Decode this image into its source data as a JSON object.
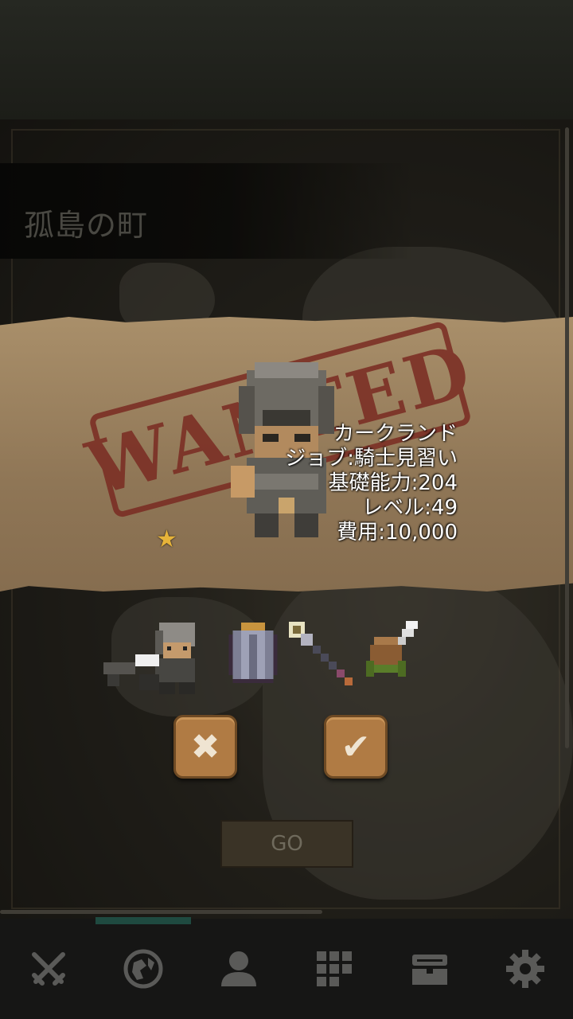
{
  "location": {
    "title": "孤島の町"
  },
  "stamp": {
    "text": "WANTED"
  },
  "recruit": {
    "name": "カークランド",
    "job": "ジョブ:騎士見習い",
    "base_power": "基礎能力:204",
    "level": "レベル:49",
    "cost": "費用:10,000",
    "stars": "★"
  },
  "equipment": {
    "icons": [
      "knight-sprite",
      "armor-icon",
      "staff-icon",
      "helmet-feather-icon"
    ]
  },
  "buttons": {
    "cancel_glyph": "✖",
    "confirm_glyph": "✔",
    "go_label": "GO"
  },
  "tabs": [
    {
      "name": "battle-tab",
      "icon": "crossed-swords-icon"
    },
    {
      "name": "world-tab",
      "icon": "globe-icon"
    },
    {
      "name": "character-tab",
      "icon": "person-icon"
    },
    {
      "name": "items-tab",
      "icon": "grid-icon"
    },
    {
      "name": "chest-tab",
      "icon": "treasure-chest-icon"
    },
    {
      "name": "settings-tab",
      "icon": "gear-icon"
    }
  ],
  "colors": {
    "accent": "#b07b44",
    "stamp": "#7a2b22",
    "tab_active": "#1f4a40"
  }
}
